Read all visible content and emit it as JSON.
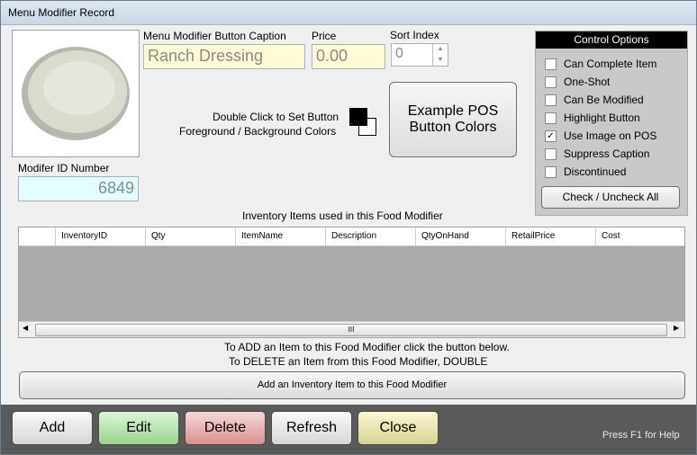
{
  "window": {
    "title": "Menu Modifier Record"
  },
  "image": {
    "icon": "ranch-dressing-bowl-image"
  },
  "caption": {
    "label": "Menu Modifier Button Caption",
    "value": "Ranch Dressing"
  },
  "price": {
    "label": "Price",
    "value": "0.00"
  },
  "sort": {
    "label": "Sort Index",
    "value": "0"
  },
  "colors": {
    "hint_line1": "Double Click to Set Button",
    "hint_line2": "Foreground / Background Colors",
    "foreground": "#000000",
    "background": "#ffffff"
  },
  "example": {
    "line1": "Example POS",
    "line2": "Button Colors"
  },
  "modifier_id": {
    "label": "Modifer ID Number",
    "value": "6849"
  },
  "control": {
    "title": "Control Options",
    "items": [
      {
        "label": "Can Complete Item",
        "checked": false
      },
      {
        "label": "One-Shot",
        "checked": false
      },
      {
        "label": "Can Be Modified",
        "checked": false
      },
      {
        "label": "Highlight Button",
        "checked": false
      },
      {
        "label": "Use Image on POS",
        "checked": true
      },
      {
        "label": "Suppress Caption",
        "checked": false
      },
      {
        "label": "Discontinued",
        "checked": false
      }
    ],
    "check_all": "Check / Uncheck All"
  },
  "inventory": {
    "title": "Inventory Items used in this Food Modifier",
    "columns": [
      "InventoryID",
      "Qty",
      "ItemName",
      "Description",
      "QtyOnHand",
      "RetailPrice",
      "Cost"
    ],
    "scroll_thumb": "III"
  },
  "instructions": {
    "line1": "To ADD an Item to this Food Modifier click the button below.",
    "line2": "To DELETE an Item from this Food Modifier, DOUBLE"
  },
  "add_inventory_label": "Add an Inventory Item to this Food Modifier",
  "buttons": {
    "add": "Add",
    "edit": "Edit",
    "delete": "Delete",
    "refresh": "Refresh",
    "close": "Close"
  },
  "help": "Press F1 for Help"
}
